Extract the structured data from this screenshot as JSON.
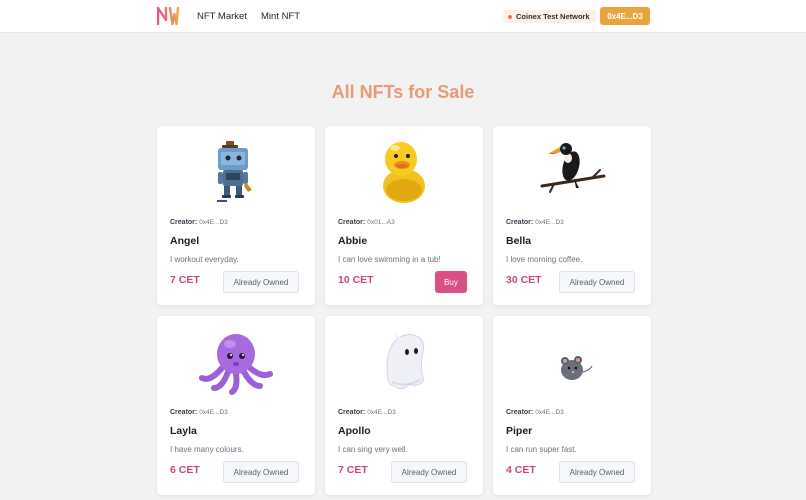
{
  "nav": {
    "links": [
      "NFT Market",
      "Mint NFT"
    ],
    "network_label": "Coinex Test Network",
    "wallet_label": "0x4E...D3"
  },
  "page": {
    "title": "All NFTs for Sale"
  },
  "creator_label": "Creator:",
  "cards": [
    {
      "creator": "0x4E...D3",
      "name": "Angel",
      "description": "I workout everyday.",
      "price": "7 CET",
      "action": "Already Owned",
      "image": "robot-figure-icon"
    },
    {
      "creator": "0x01...A3",
      "name": "Abbie",
      "description": "I can love swimming in a tub!",
      "price": "10 CET",
      "action": "Buy",
      "image": "rubber-duck-icon"
    },
    {
      "creator": "0x4E...D3",
      "name": "Bella",
      "description": "I love morning coffee.",
      "price": "30 CET",
      "action": "Already Owned",
      "image": "toucan-bird-icon"
    },
    {
      "creator": "0x4E...D3",
      "name": "Layla",
      "description": "I have many colours.",
      "price": "6 CET",
      "action": "Already Owned",
      "image": "purple-octopus-icon"
    },
    {
      "creator": "0x4E...D3",
      "name": "Apollo",
      "description": "I can sing very well.",
      "price": "7 CET",
      "action": "Already Owned",
      "image": "ghost-figure-icon"
    },
    {
      "creator": "0x4E...D3",
      "name": "Piper",
      "description": "I can run super fast.",
      "price": "4 CET",
      "action": "Already Owned",
      "image": "mouse-figure-icon"
    }
  ],
  "colors": {
    "accent": "#e9a43d",
    "title": "#ea9a74",
    "price": "#d2437e",
    "buy": "#da4f86"
  }
}
